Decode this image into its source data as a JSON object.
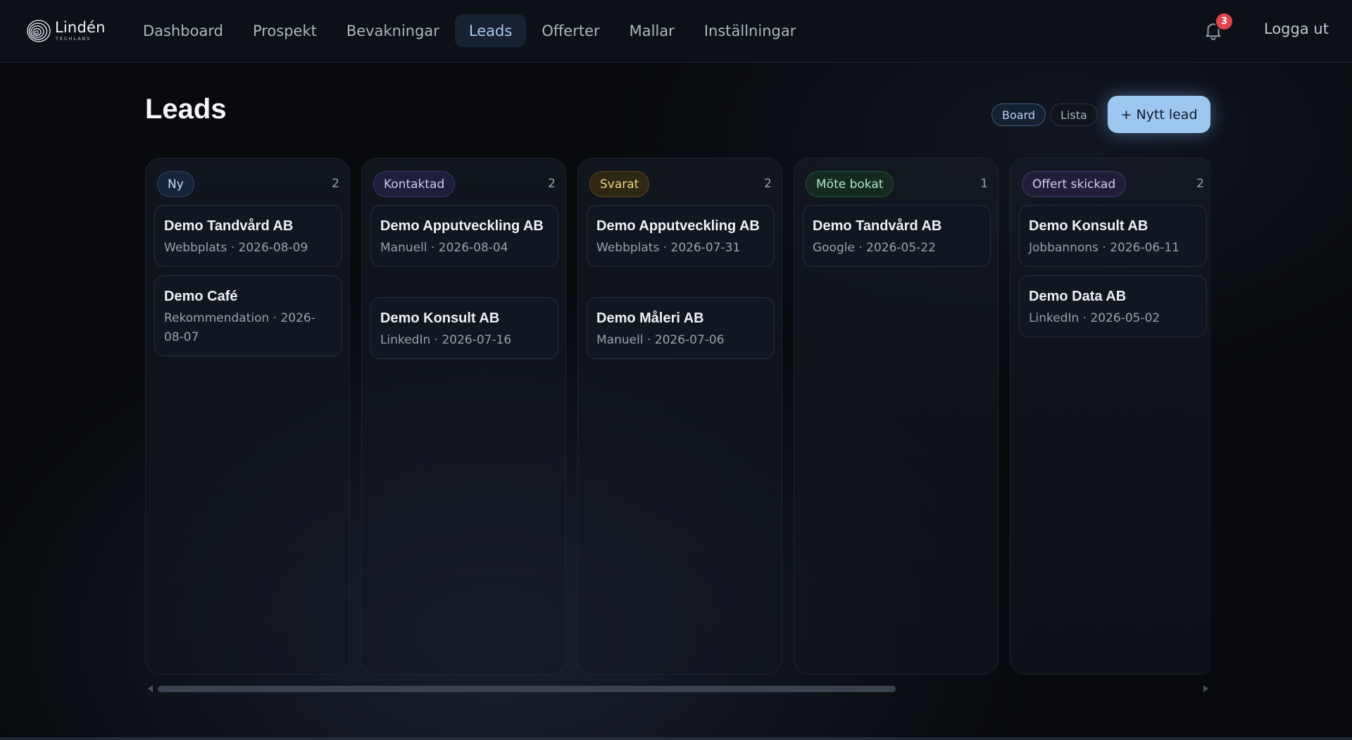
{
  "brand": {
    "name": "Lindén",
    "tagline": "TECHLABS"
  },
  "nav": {
    "items": [
      {
        "label": "Dashboard",
        "active": false
      },
      {
        "label": "Prospekt",
        "active": false
      },
      {
        "label": "Bevakningar",
        "active": false
      },
      {
        "label": "Leads",
        "active": true
      },
      {
        "label": "Offerter",
        "active": false
      },
      {
        "label": "Mallar",
        "active": false
      },
      {
        "label": "Inställningar",
        "active": false
      }
    ],
    "notification_count": "3",
    "logout_label": "Logga ut"
  },
  "page": {
    "title": "Leads",
    "view_toggle": [
      {
        "label": "Board",
        "active": true
      },
      {
        "label": "Lista",
        "active": false
      }
    ],
    "new_lead_label": "+ Nytt lead"
  },
  "board": {
    "columns": [
      {
        "status": "Ny",
        "count": "2",
        "pill_colors": {
          "bg": "#15263a",
          "border": "#2c4563",
          "text": "#c9ddf3"
        },
        "cards": [
          {
            "title": "Demo Tandvård AB",
            "meta": "Webbplats · 2026-08-09"
          },
          {
            "title": "Demo Café",
            "meta": "Rekommendation · 2026-08-07"
          }
        ]
      },
      {
        "status": "Kontaktad",
        "count": "2",
        "pill_colors": {
          "bg": "#1e1f3b",
          "border": "#3a3c6a",
          "text": "#c8caf3"
        },
        "cards": [
          {
            "title": "Demo Apputveckling AB",
            "meta": "Manuell · 2026-08-04"
          },
          {
            "title": "Demo Konsult AB",
            "meta": "LinkedIn · 2026-07-16"
          }
        ]
      },
      {
        "status": "Svarat",
        "count": "2",
        "pill_colors": {
          "bg": "#2e2714",
          "border": "#5a4a21",
          "text": "#f0d48a"
        },
        "cards": [
          {
            "title": "Demo Apputveckling AB",
            "meta": "Webbplats · 2026-07-31"
          },
          {
            "title": "Demo Måleri AB",
            "meta": "Manuell · 2026-07-06"
          }
        ]
      },
      {
        "status": "Möte bokat",
        "count": "1",
        "pill_colors": {
          "bg": "#142a20",
          "border": "#27503b",
          "text": "#b5e6c7"
        },
        "cards": [
          {
            "title": "Demo Tandvård AB",
            "meta": "Google · 2026-05-22"
          }
        ]
      },
      {
        "status": "Offert skickad",
        "count": "2",
        "pill_colors": {
          "bg": "#211f38",
          "border": "#403c6a",
          "text": "#d2cdf5"
        },
        "cards": [
          {
            "title": "Demo Konsult AB",
            "meta": "Jobbannons · 2026-06-11"
          },
          {
            "title": "Demo Data AB",
            "meta": "LinkedIn · 2026-05-02"
          }
        ]
      }
    ]
  }
}
